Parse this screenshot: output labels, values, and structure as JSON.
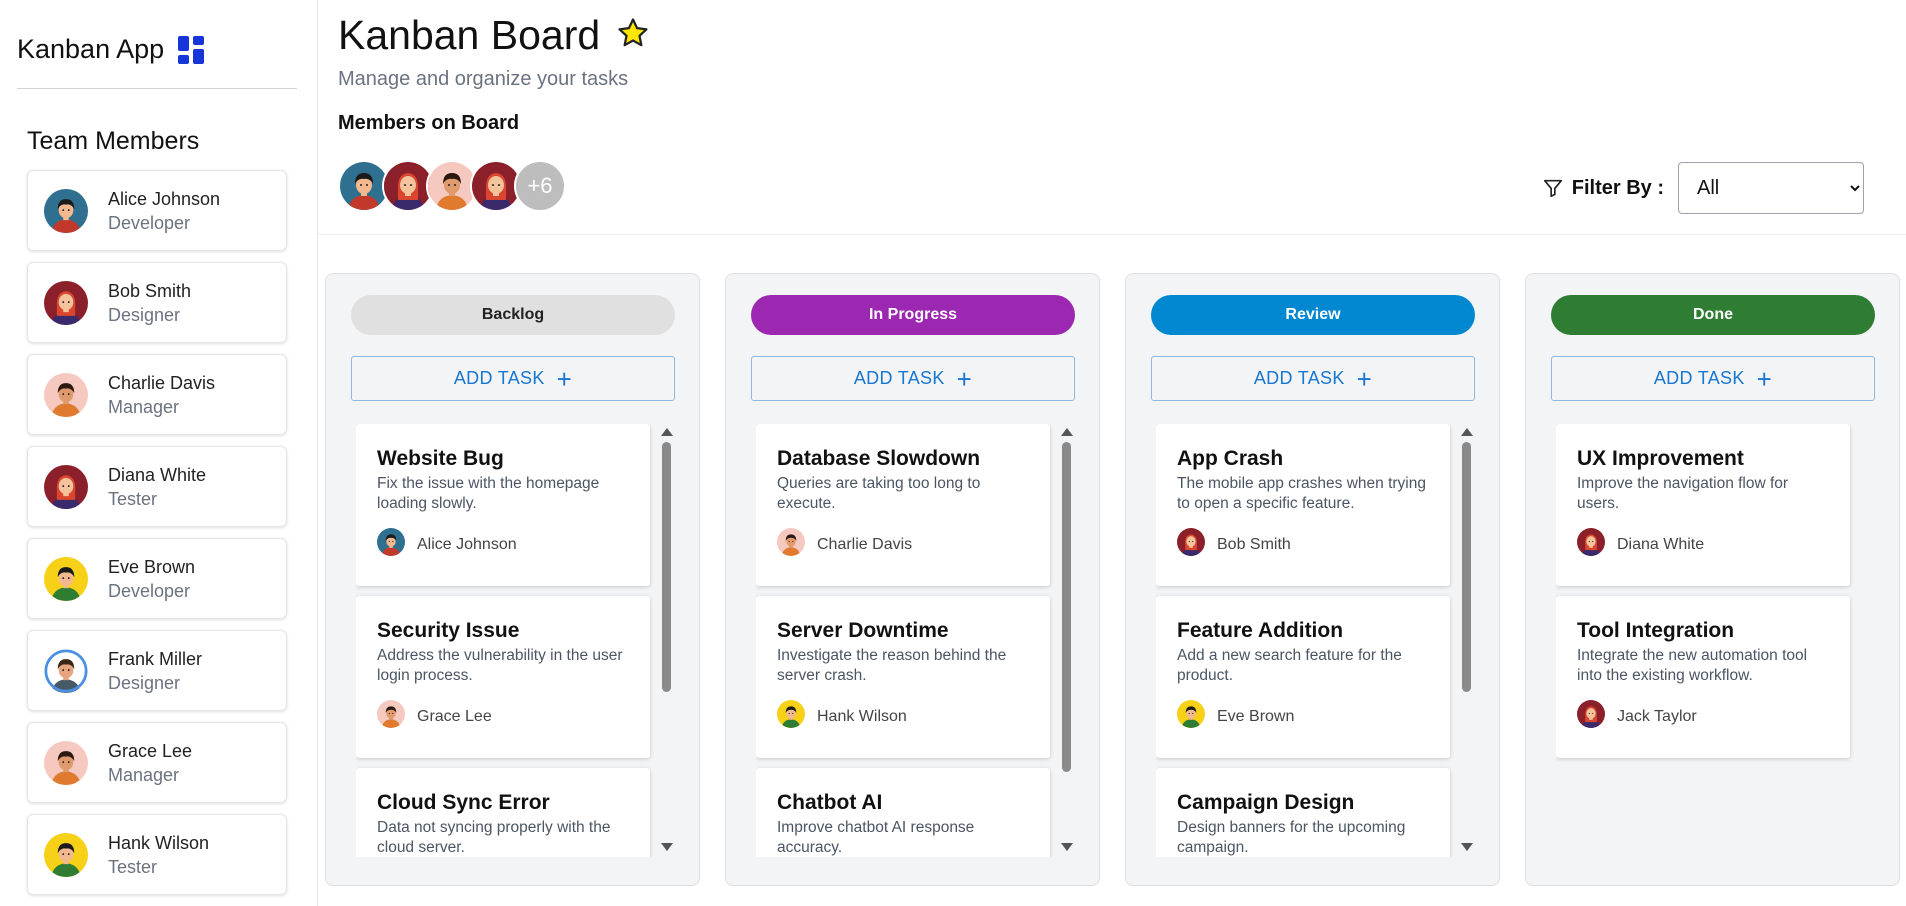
{
  "app": {
    "brand": "Kanban App",
    "team_title": "Team Members"
  },
  "members": [
    {
      "name": "Alice Johnson",
      "role": "Developer",
      "avatar": "avatar-alice"
    },
    {
      "name": "Bob Smith",
      "role": "Designer",
      "avatar": "avatar-bob"
    },
    {
      "name": "Charlie Davis",
      "role": "Manager",
      "avatar": "avatar-charlie"
    },
    {
      "name": "Diana White",
      "role": "Tester",
      "avatar": "avatar-diana"
    },
    {
      "name": "Eve Brown",
      "role": "Developer",
      "avatar": "avatar-eve"
    },
    {
      "name": "Frank Miller",
      "role": "Designer",
      "avatar": "avatar-frank"
    },
    {
      "name": "Grace Lee",
      "role": "Manager",
      "avatar": "avatar-grace"
    },
    {
      "name": "Hank Wilson",
      "role": "Tester",
      "avatar": "avatar-hank"
    }
  ],
  "header": {
    "title": "Kanban Board",
    "subtitle": "Manage and organize your tasks",
    "members_label": "Members on Board",
    "more_count": "+6",
    "filter_label": "Filter By :",
    "filter_value": "All"
  },
  "columns": [
    {
      "name": "Backlog",
      "color": "#e0e0e0",
      "text_color": "#222222",
      "add_label": "ADD TASK",
      "tasks": [
        {
          "title": "Website Bug",
          "desc": "Fix the issue with the homepage loading slowly.",
          "assignee": "Alice Johnson"
        },
        {
          "title": "Security Issue",
          "desc": "Address the vulnerability in the user login process.",
          "assignee": "Grace Lee"
        },
        {
          "title": "Cloud Sync Error",
          "desc": "Data not syncing properly with the cloud server.",
          "assignee": ""
        }
      ]
    },
    {
      "name": "In Progress",
      "color": "#9c27b0",
      "text_color": "#ffffff",
      "add_label": "ADD TASK",
      "tasks": [
        {
          "title": "Database Slowdown",
          "desc": "Queries are taking too long to execute.",
          "assignee": "Charlie Davis"
        },
        {
          "title": "Server Downtime",
          "desc": "Investigate the reason behind the server crash.",
          "assignee": "Hank Wilson"
        },
        {
          "title": "Chatbot AI",
          "desc": "Improve chatbot AI response accuracy.",
          "assignee": ""
        }
      ]
    },
    {
      "name": "Review",
      "color": "#0288d1",
      "text_color": "#ffffff",
      "add_label": "ADD TASK",
      "tasks": [
        {
          "title": "App Crash",
          "desc": "The mobile app crashes when trying to open a specific feature.",
          "assignee": "Bob Smith"
        },
        {
          "title": "Feature Addition",
          "desc": "Add a new search feature for the product.",
          "assignee": "Eve Brown"
        },
        {
          "title": "Campaign Design",
          "desc": "Design banners for the upcoming campaign.",
          "assignee": ""
        }
      ]
    },
    {
      "name": "Done",
      "color": "#2e7d32",
      "text_color": "#ffffff",
      "add_label": "ADD TASK",
      "tasks": [
        {
          "title": "UX Improvement",
          "desc": "Improve the navigation flow for users.",
          "assignee": "Diana White"
        },
        {
          "title": "Tool Integration",
          "desc": "Integrate the new automation tool into the existing workflow.",
          "assignee": "Jack Taylor"
        }
      ]
    }
  ]
}
